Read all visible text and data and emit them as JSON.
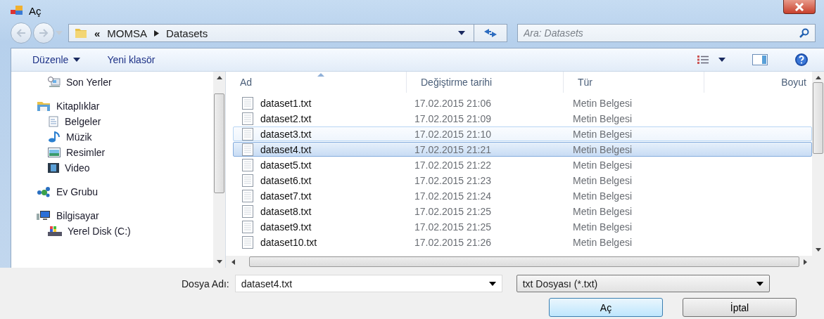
{
  "window": {
    "title": "Aç"
  },
  "address": {
    "overflow": "«",
    "crumbs": [
      "MOMSA",
      "Datasets"
    ]
  },
  "search": {
    "placeholder": "Ara: Datasets"
  },
  "toolbar": {
    "organize": "Düzenle",
    "new_folder": "Yeni klasör"
  },
  "sidebar": {
    "items": [
      {
        "children": [
          {
            "label": "Son Yerler",
            "kind": "recent"
          }
        ]
      },
      {
        "label": "Kitaplıklar",
        "kind": "library",
        "children": [
          {
            "label": "Belgeler",
            "kind": "documents"
          },
          {
            "label": "Müzik",
            "kind": "music"
          },
          {
            "label": "Resimler",
            "kind": "pictures"
          },
          {
            "label": "Video",
            "kind": "video"
          }
        ]
      },
      {
        "label": "Ev Grubu",
        "kind": "homegroup"
      },
      {
        "label": "Bilgisayar",
        "kind": "computer",
        "children": [
          {
            "label": "Yerel Disk (C:)",
            "kind": "disk"
          }
        ]
      }
    ]
  },
  "table": {
    "columns": [
      "Ad",
      "Değiştirme tarihi",
      "Tür",
      "Boyut"
    ],
    "rows": [
      {
        "name": "dataset1.txt",
        "date": "17.02.2015 21:06",
        "type": "Metin Belgesi",
        "selected": false,
        "hovered": false
      },
      {
        "name": "dataset2.txt",
        "date": "17.02.2015 21:09",
        "type": "Metin Belgesi",
        "selected": false,
        "hovered": false
      },
      {
        "name": "dataset3.txt",
        "date": "17.02.2015 21:10",
        "type": "Metin Belgesi",
        "selected": false,
        "hovered": true
      },
      {
        "name": "dataset4.txt",
        "date": "17.02.2015 21:21",
        "type": "Metin Belgesi",
        "selected": true,
        "hovered": false
      },
      {
        "name": "dataset5.txt",
        "date": "17.02.2015 21:22",
        "type": "Metin Belgesi",
        "selected": false,
        "hovered": false
      },
      {
        "name": "dataset6.txt",
        "date": "17.02.2015 21:23",
        "type": "Metin Belgesi",
        "selected": false,
        "hovered": false
      },
      {
        "name": "dataset7.txt",
        "date": "17.02.2015 21:24",
        "type": "Metin Belgesi",
        "selected": false,
        "hovered": false
      },
      {
        "name": "dataset8.txt",
        "date": "17.02.2015 21:25",
        "type": "Metin Belgesi",
        "selected": false,
        "hovered": false
      },
      {
        "name": "dataset9.txt",
        "date": "17.02.2015 21:25",
        "type": "Metin Belgesi",
        "selected": false,
        "hovered": false
      },
      {
        "name": "dataset10.txt",
        "date": "17.02.2015 21:26",
        "type": "Metin Belgesi",
        "selected": false,
        "hovered": false
      }
    ]
  },
  "filename": {
    "label": "Dosya Adı:",
    "value": "dataset4.txt"
  },
  "filter": {
    "value": "txt Dosyası  (*.txt)"
  },
  "buttons": [
    "Aç",
    "İptal"
  ]
}
